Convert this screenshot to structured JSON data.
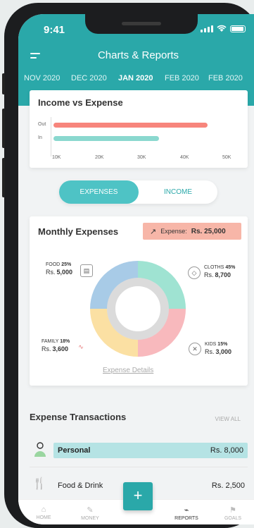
{
  "status": {
    "time": "9:41"
  },
  "header": {
    "title": "Charts & Reports",
    "months": [
      "NOV 2020",
      "DEC 2020",
      "JAN 2020",
      "FEB 2020",
      "FEB 2020"
    ],
    "active_month": "JAN 2020"
  },
  "income_expense": {
    "title": "Income vs Expense",
    "rows": [
      {
        "label": "Out",
        "value": 45000,
        "color": "#f7857c"
      },
      {
        "label": "In",
        "value": 34000,
        "color": "#8ad8cf"
      }
    ],
    "ticks": [
      "10K",
      "20K",
      "30K",
      "40K",
      "50K"
    ]
  },
  "toggle": {
    "expenses": "EXPENSES",
    "income": "INCOME"
  },
  "monthly": {
    "title": "Monthly Expenses",
    "badge_label": "Expense:",
    "badge_value": "Rs. 25,000",
    "categories": [
      {
        "name": "FOOD",
        "pct": "25%",
        "amount": "5,000",
        "prefix": "Rs.",
        "color": "#a8cbe7",
        "share": 25,
        "icon": "receipt-icon"
      },
      {
        "name": "CLOTHS",
        "pct": "45%",
        "amount": "8,700",
        "prefix": "Rs.",
        "color": "#9fe3d2",
        "share": 25,
        "icon": "diamond-icon"
      },
      {
        "name": "KIDS",
        "pct": "15%",
        "amount": "3,000",
        "prefix": "Rs.",
        "color": "#f8b9bd",
        "share": 25,
        "icon": "ball-icon"
      },
      {
        "name": "FAMILY",
        "pct": "18%",
        "amount": "3,600",
        "prefix": "Rs.",
        "color": "#fbe0a3",
        "share": 25,
        "icon": "heartbeat-icon"
      }
    ],
    "details_link": "Expense Details"
  },
  "transactions": {
    "title": "Expense Transactions",
    "view_all": "VIEW ALL",
    "items": [
      {
        "name": "Personal",
        "amount": "Rs. 8,000",
        "icon": "person-icon"
      },
      {
        "name": "Food & Drink",
        "amount": "Rs. 2,500",
        "icon": "food-icon"
      }
    ]
  },
  "tabs": [
    {
      "label": "HOME",
      "icon": "home-icon"
    },
    {
      "label": "MONEY",
      "icon": "money-icon"
    },
    {
      "label": "REPORTS",
      "icon": "chart-icon"
    },
    {
      "label": "GOALS",
      "icon": "flag-icon"
    }
  ],
  "fab_label": "+"
}
